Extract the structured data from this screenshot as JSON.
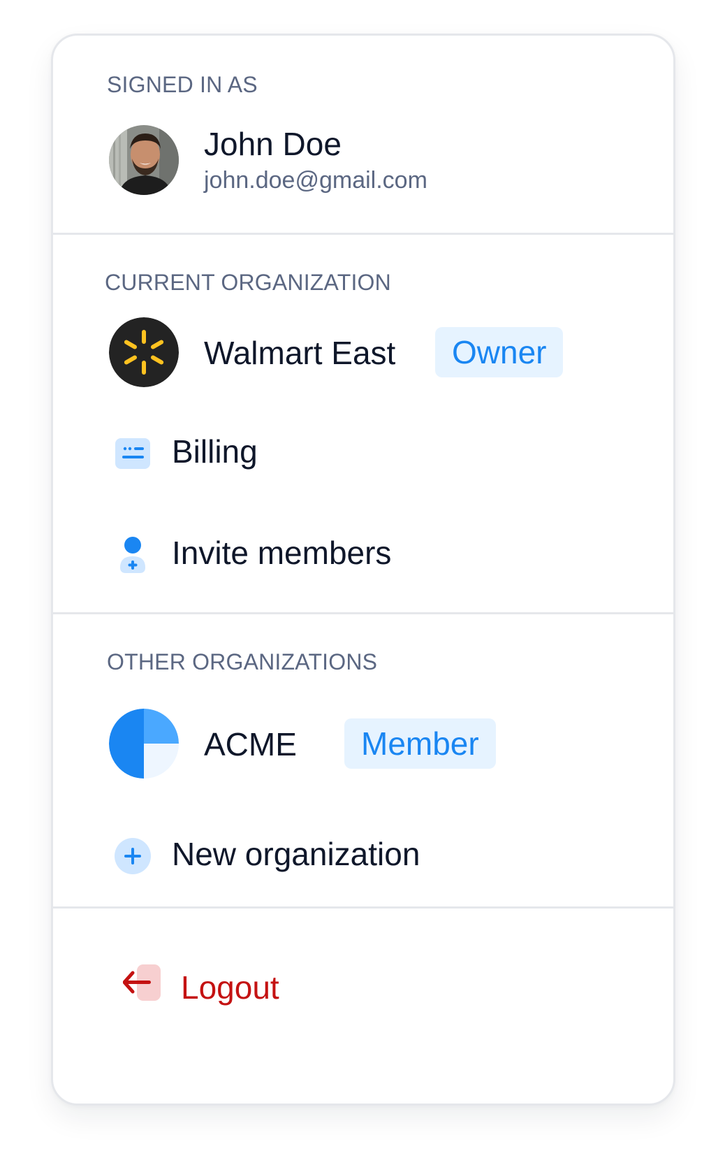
{
  "signed_in": {
    "label": "SIGNED IN AS",
    "user": {
      "name": "John Doe",
      "email": "john.doe@gmail.com"
    }
  },
  "current_org": {
    "label": "CURRENT ORGANIZATION",
    "name": "Walmart East",
    "role": "Owner",
    "logo_color": "#ffc220",
    "logo_bg": "#232323"
  },
  "menu": {
    "billing": "Billing",
    "invite": "Invite members"
  },
  "other_orgs": {
    "label": "OTHER ORGANIZATIONS",
    "items": [
      {
        "name": "ACME",
        "role": "Member"
      }
    ],
    "new_org": "New organization"
  },
  "logout": {
    "label": "Logout",
    "color": "#c41212"
  },
  "colors": {
    "accent": "#1a86f2",
    "badge_bg": "#e6f3ff",
    "muted_text": "#5b6782",
    "divider": "#e5e7eb"
  },
  "icons": {
    "billing": "billing-card-icon",
    "invite": "user-plus-icon",
    "new_org": "plus-circle-icon",
    "logout": "logout-arrow-icon"
  }
}
